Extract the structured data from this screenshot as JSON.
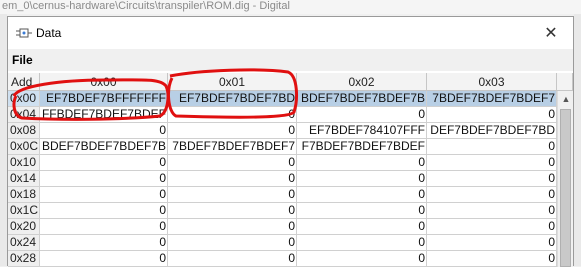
{
  "background_title": "em_0\\cernus-hardware\\Circuits\\transpiler\\ROM.dig - Digital",
  "window": {
    "title": "Data",
    "close_glyph": "✕"
  },
  "menu": {
    "file_label": "File"
  },
  "table": {
    "header": {
      "addr": "Add",
      "cols": [
        "0x00",
        "0x01",
        "0x02",
        "0x03"
      ]
    },
    "rows": [
      {
        "addr": "0x00",
        "cells": [
          "EF7BDEF7BFFFFFFF",
          "EF7BDEF7BDEF7BD",
          "BDEF7BDEF7BDEF7B",
          "7BDEF7BDEF7BDEF7"
        ]
      },
      {
        "addr": "0x04",
        "cells": [
          "FFBDEF7BDEF7BDEF",
          "0",
          "0",
          "0"
        ]
      },
      {
        "addr": "0x08",
        "cells": [
          "0",
          "0",
          "EF7BDEF784107FFF",
          "DEF7BDEF7BDEF7BD"
        ]
      },
      {
        "addr": "0x0C",
        "cells": [
          "BDEF7BDEF7BDEF7B",
          "7BDEF7BDEF7BDEF7",
          "F7BDEF7BDEF7BDEF",
          "0"
        ]
      },
      {
        "addr": "0x10",
        "cells": [
          "0",
          "0",
          "0",
          "0"
        ]
      },
      {
        "addr": "0x14",
        "cells": [
          "0",
          "0",
          "0",
          "0"
        ]
      },
      {
        "addr": "0x18",
        "cells": [
          "0",
          "0",
          "0",
          "0"
        ]
      },
      {
        "addr": "0x1C",
        "cells": [
          "0",
          "0",
          "0",
          "0"
        ]
      },
      {
        "addr": "0x20",
        "cells": [
          "0",
          "0",
          "0",
          "0"
        ]
      },
      {
        "addr": "0x24",
        "cells": [
          "0",
          "0",
          "0",
          "0"
        ]
      },
      {
        "addr": "0x28",
        "cells": [
          "0",
          "0",
          "0",
          "0"
        ]
      }
    ]
  },
  "icons": {
    "app": "digital-app-icon",
    "close": "close-icon",
    "scroll_up": "scroll-up-arrow-icon"
  },
  "colors": {
    "selection": "#b8cfe5",
    "annotation": "#e01010"
  }
}
